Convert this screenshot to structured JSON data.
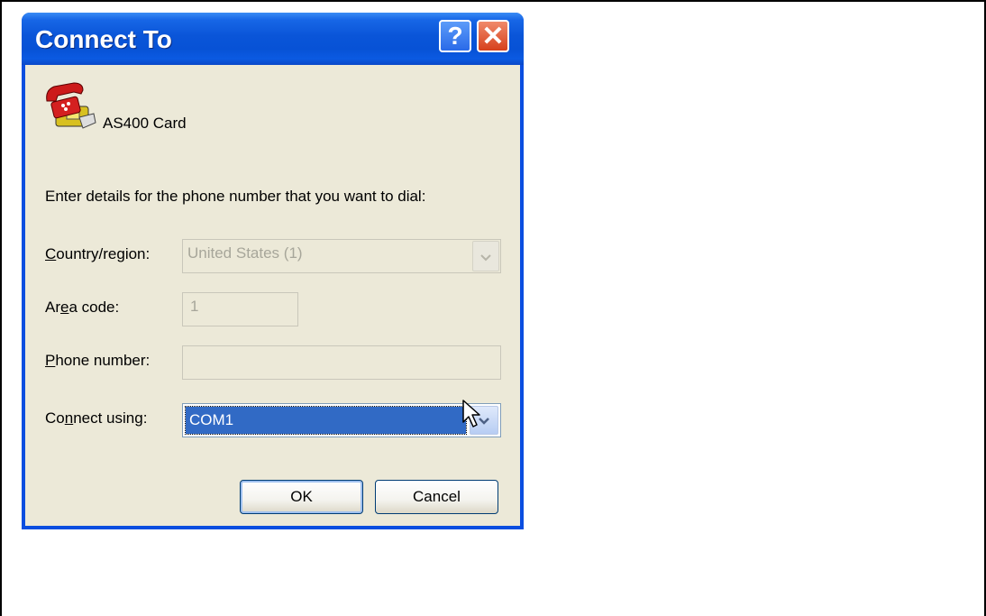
{
  "dialog": {
    "title": "Connect To",
    "help_symbol": "?",
    "close_symbol": "✕",
    "connection_name": "AS400 Card",
    "instruction": "Enter details for the phone number that you want to dial:",
    "country": {
      "label_pre": "",
      "label_key": "C",
      "label_post": "ountry/region:",
      "value": "United States (1)"
    },
    "area_code": {
      "label_pre": "Ar",
      "label_key": "e",
      "label_post": "a code:",
      "value": "1"
    },
    "phone_number": {
      "label_pre": "",
      "label_key": "P",
      "label_post": "hone number:",
      "value": ""
    },
    "connect_using": {
      "label_pre": "Co",
      "label_key": "n",
      "label_post": "nect using:",
      "value": "COM1"
    },
    "ok_label": "OK",
    "cancel_label": "Cancel"
  },
  "icons": {
    "app": "telephone-icon",
    "help": "help-icon",
    "close": "close-icon",
    "dropdown": "chevron-down-icon",
    "cursor": "mouse-pointer-icon"
  },
  "colors": {
    "titlebar": "#0a55d8",
    "client_background": "#ece9d8",
    "selection": "#316ac5",
    "close_button": "#d6401c"
  }
}
